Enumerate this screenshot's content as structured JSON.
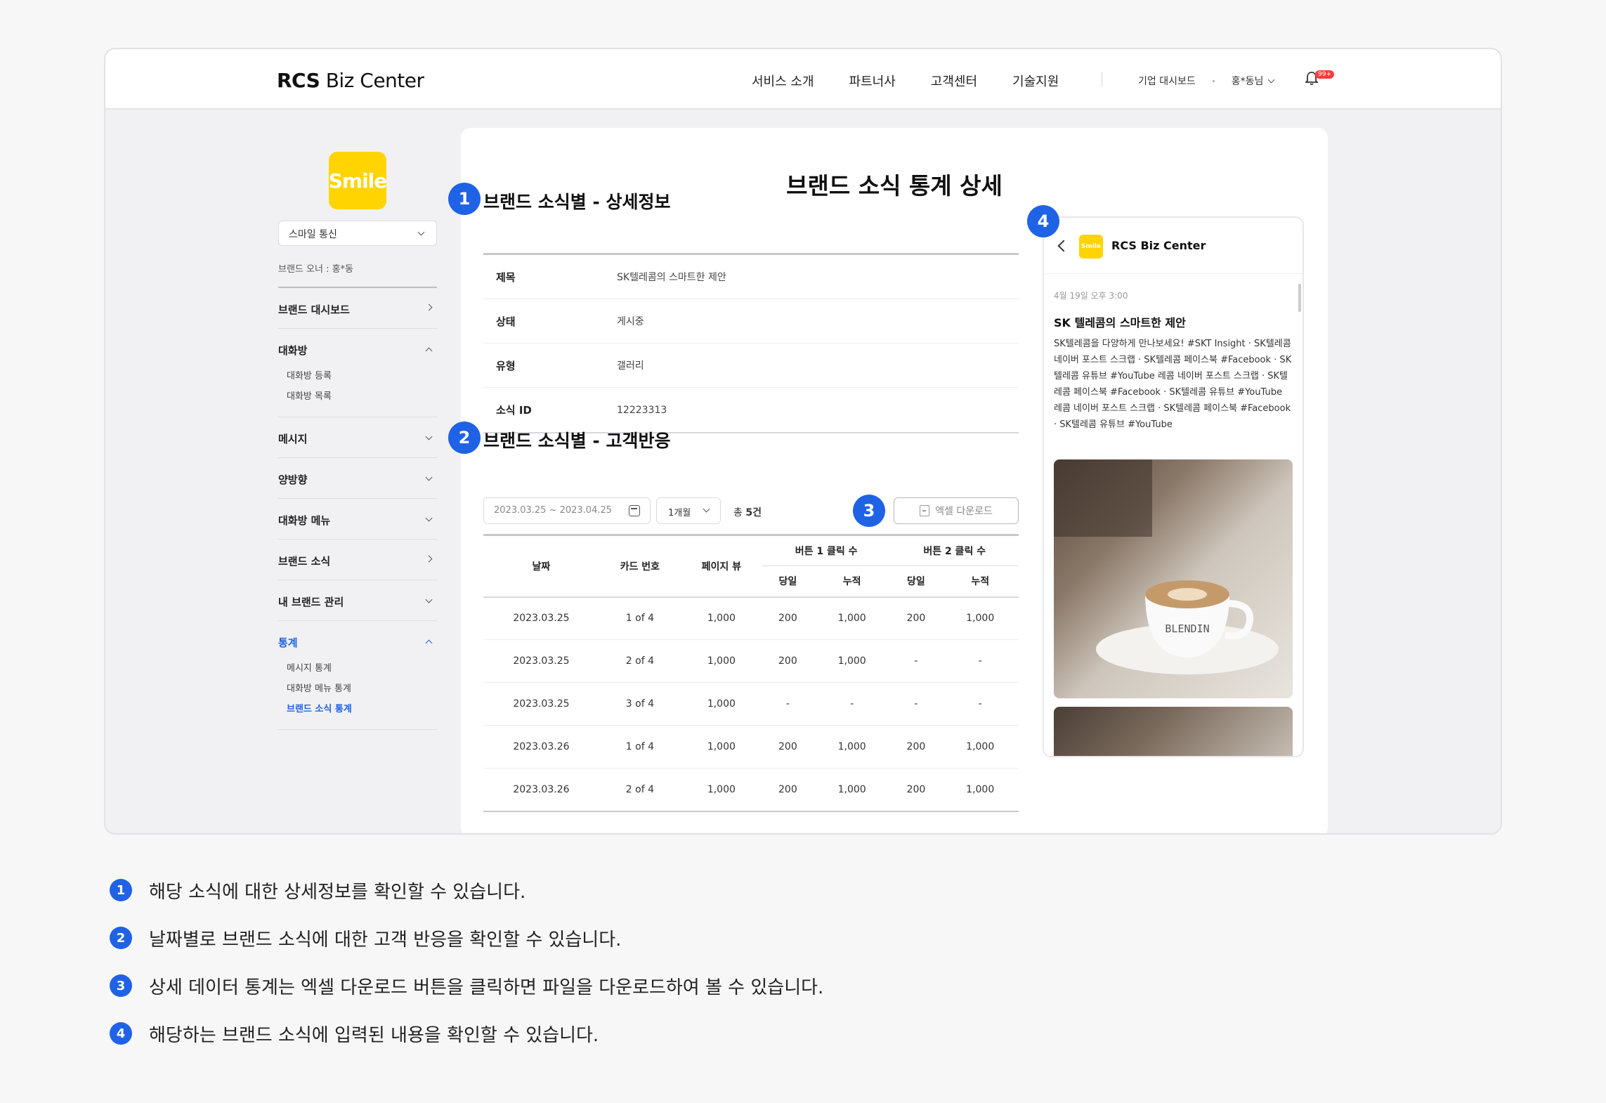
{
  "header": {
    "logo_bold": "RCS",
    "logo_rest": " Biz Center",
    "nav": [
      "서비스 소개",
      "파트너사",
      "고객센터",
      "기술지원"
    ],
    "dashboard_link": "기업 대시보드",
    "user_name": "홍*동님",
    "notification_badge": "99+"
  },
  "sidebar": {
    "brand_logo_text": "Smile",
    "brand_select": "스마일 통신",
    "owner": "브랜드 오너 : 홍*동",
    "menu": {
      "dashboard": "브랜드 대시보드",
      "chatroom": "대화방",
      "chatroom_register": "대화방 등록",
      "chatroom_list": "대화방 목록",
      "message": "메시지",
      "two_way": "양방향",
      "chatroom_menu": "대화방 메뉴",
      "brand_news": "브랜드 소식",
      "my_brand": "내 브랜드 관리",
      "stats": "통계",
      "stats_message": "메시지 통계",
      "stats_chat_menu": "대화방 메뉴 통계",
      "stats_brand_news": "브랜드 소식 통계"
    }
  },
  "main": {
    "page_title": "브랜드 소식 통계 상세",
    "section1_title": "브랜드 소식별 - 상세정보",
    "section2_title": "브랜드 소식별 - 고객반응",
    "info": [
      {
        "key": "제목",
        "value": "SK텔레콤의 스마트한 제안"
      },
      {
        "key": "상태",
        "value": "게시중"
      },
      {
        "key": "유형",
        "value": "갤러리"
      },
      {
        "key": "소식 ID",
        "value": "12223313"
      }
    ],
    "filters": {
      "date_range": "2023.03.25 ~ 2023.04.25",
      "period": "1개월",
      "total_prefix": "총 ",
      "total_count": "5건",
      "excel_button": "엑셀 다운로드"
    },
    "table": {
      "headers": {
        "date": "날짜",
        "card": "카드 번호",
        "pageview": "페이지 뷰",
        "btn1": "버튼 1 클릭 수",
        "btn2": "버튼 2 클릭 수",
        "today": "당일",
        "cumulative": "누적"
      },
      "rows": [
        [
          "2023.03.25",
          "1 of 4",
          "1,000",
          "200",
          "1,000",
          "200",
          "1,000"
        ],
        [
          "2023.03.25",
          "2 of 4",
          "1,000",
          "200",
          "1,000",
          "-",
          "-"
        ],
        [
          "2023.03.25",
          "3 of 4",
          "1,000",
          "-",
          "-",
          "-",
          "-"
        ],
        [
          "2023.03.26",
          "1 of 4",
          "1,000",
          "200",
          "1,000",
          "200",
          "1,000"
        ],
        [
          "2023.03.26",
          "2 of 4",
          "1,000",
          "200",
          "1,000",
          "200",
          "1,000"
        ]
      ]
    },
    "markers": [
      "1",
      "2",
      "3",
      "4"
    ]
  },
  "preview": {
    "logo_text": "Smile",
    "title": "RCS Biz Center",
    "time": "4월 19일 오후 3:00",
    "headline": "SK 텔레콤의 스마트한 제안",
    "body": "SK텔레콤을 다양하게 만나보세요! #SKT Insight · SK텔레콤 네이버 포스트 스크랩 · SK텔레콤 페이스북 #Facebook · SK텔레콤 유튜브 #YouTube 레콤 네이버 포스트 스크랩 · SK텔레콤 페이스북 #Facebook · SK텔레콤 유튜브 #YouTube 레콤 네이버 포스트 스크랩 · SK텔레콤 페이스북 #Facebook · SK텔레콤 유튜브 #YouTube",
    "cup_text": "BLENDIN"
  },
  "notes": [
    {
      "num": "1",
      "text": "해당 소식에 대한 상세정보를 확인할 수 있습니다."
    },
    {
      "num": "2",
      "text": "날짜별로 브랜드 소식에 대한 고객 반응을 확인할 수 있습니다."
    },
    {
      "num": "3",
      "text": "상세 데이터 통계는 엑셀 다운로드 버튼을 클릭하면 파일을 다운로드하여 볼 수 있습니다."
    },
    {
      "num": "4",
      "text": "해당하는 브랜드 소식에 입력된 내용을 확인할 수 있습니다."
    }
  ],
  "colors": {
    "accent": "#1f62e6",
    "brand_yellow": "#ffd400",
    "badge_red": "#ff3b3b"
  }
}
